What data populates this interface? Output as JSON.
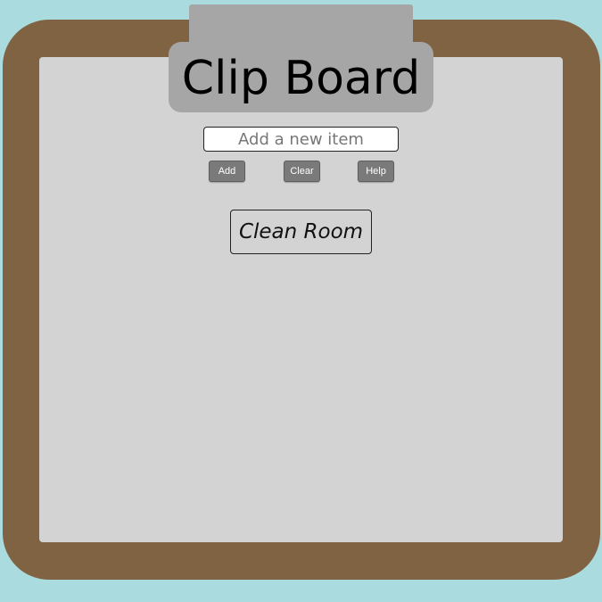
{
  "app": {
    "title": "Clip Board"
  },
  "input": {
    "placeholder": "Add a new item",
    "value": ""
  },
  "buttons": {
    "add_label": "Add",
    "clear_label": "Clear",
    "help_label": "Help"
  },
  "items": [
    {
      "label": "Clean Room"
    }
  ],
  "colors": {
    "background": "#a9dbdf",
    "board": "#806342",
    "paper": "#d3d3d3",
    "clip": "#a6a6a6",
    "button": "#7a7a7a"
  }
}
